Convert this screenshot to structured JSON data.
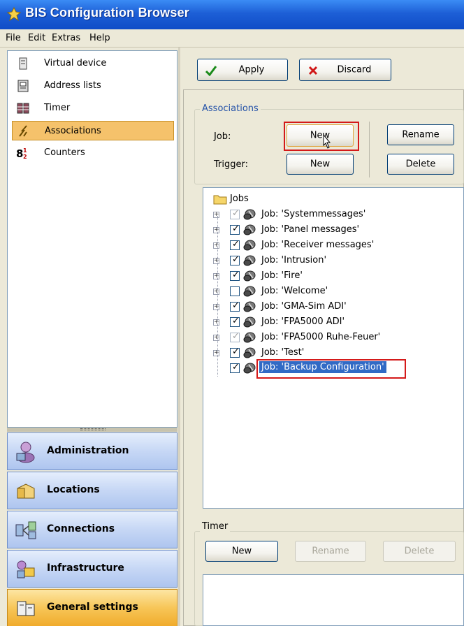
{
  "window": {
    "title": "BIS Configuration Browser"
  },
  "menu": [
    "File",
    "Edit",
    "Extras",
    "Help"
  ],
  "sidebar": {
    "items": [
      {
        "label": "Virtual device",
        "icon": "device-icon"
      },
      {
        "label": "Address lists",
        "icon": "address-list-icon"
      },
      {
        "label": "Timer",
        "icon": "timer-icon"
      },
      {
        "label": "Associations",
        "icon": "associations-icon",
        "selected": true
      },
      {
        "label": "Counters",
        "icon": "counters-icon"
      }
    ]
  },
  "nav": [
    {
      "label": "Administration",
      "icon": "administration-icon"
    },
    {
      "label": "Locations",
      "icon": "locations-icon"
    },
    {
      "label": "Connections",
      "icon": "connections-icon"
    },
    {
      "label": "Infrastructure",
      "icon": "infrastructure-icon"
    },
    {
      "label": "General settings",
      "icon": "general-settings-icon",
      "active": true
    }
  ],
  "toolbar": {
    "apply_label": "Apply",
    "discard_label": "Discard"
  },
  "associations": {
    "title": "Associations",
    "job_label": "Job:",
    "trigger_label": "Trigger:",
    "job_new": "New",
    "trigger_new": "New",
    "rename": "Rename",
    "delete": "Delete"
  },
  "jobs_tree": {
    "root": "Jobs",
    "items": [
      {
        "label": "Job: 'Systemmessages'",
        "checked": true,
        "greyed": true
      },
      {
        "label": "Job: 'Panel messages'",
        "checked": true,
        "greyed": false
      },
      {
        "label": "Job: 'Receiver messages'",
        "checked": true,
        "greyed": false
      },
      {
        "label": "Job: 'Intrusion'",
        "checked": true,
        "greyed": false
      },
      {
        "label": "Job: 'Fire'",
        "checked": true,
        "greyed": false
      },
      {
        "label": "Job: 'Welcome'",
        "checked": false,
        "greyed": false
      },
      {
        "label": "Job: 'GMA-Sim ADI'",
        "checked": true,
        "greyed": false
      },
      {
        "label": "Job: 'FPA5000 ADI'",
        "checked": true,
        "greyed": false
      },
      {
        "label": "Job: 'FPA5000 Ruhe-Feuer'",
        "checked": true,
        "greyed": true
      },
      {
        "label": "Job: 'Test'",
        "checked": true,
        "greyed": false
      },
      {
        "label": "Job: 'Backup Configuration'",
        "checked": true,
        "greyed": false,
        "selected": true
      }
    ]
  },
  "timer": {
    "title": "Timer",
    "new": "New",
    "rename": "Rename",
    "delete": "Delete"
  }
}
